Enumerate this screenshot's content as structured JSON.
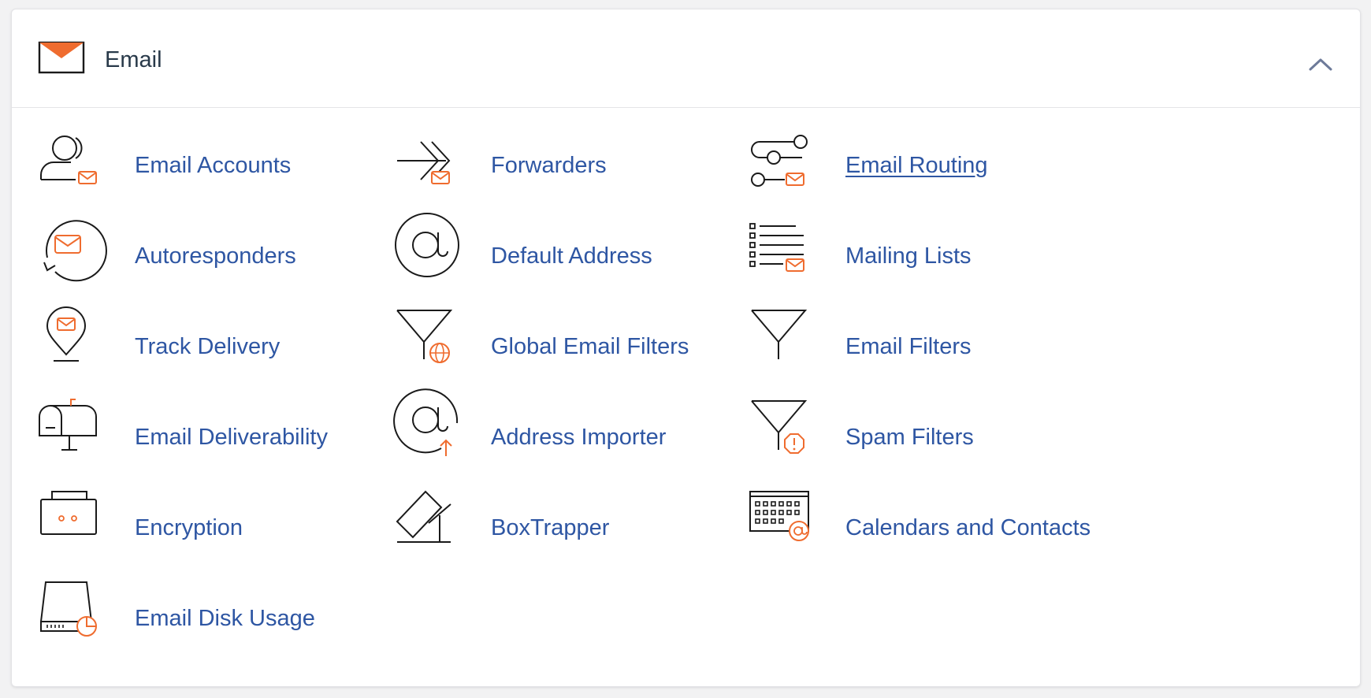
{
  "section": {
    "title": "Email",
    "icon": "envelope-icon",
    "collapse_icon": "chevron-up-icon"
  },
  "colors": {
    "link": "#2e56a3",
    "accent": "#ef6c2f",
    "icon_stroke": "#1a1a1a"
  },
  "items": [
    {
      "label": "Email Accounts",
      "icon": "user-mail-icon"
    },
    {
      "label": "Forwarders",
      "icon": "forward-arrow-icon"
    },
    {
      "label": "Email Routing",
      "icon": "routing-icon"
    },
    {
      "label": "Autoresponders",
      "icon": "autoresponder-icon"
    },
    {
      "label": "Default Address",
      "icon": "at-sign-icon"
    },
    {
      "label": "Mailing Lists",
      "icon": "list-mail-icon"
    },
    {
      "label": "Track Delivery",
      "icon": "location-pin-mail-icon"
    },
    {
      "label": "Global Email Filters",
      "icon": "filter-globe-icon"
    },
    {
      "label": "Email Filters",
      "icon": "filter-icon"
    },
    {
      "label": "Email Deliverability",
      "icon": "mailbox-icon"
    },
    {
      "label": "Address Importer",
      "icon": "at-sign-upload-icon"
    },
    {
      "label": "Spam Filters",
      "icon": "filter-warning-icon"
    },
    {
      "label": "Encryption",
      "icon": "lock-briefcase-icon"
    },
    {
      "label": "BoxTrapper",
      "icon": "box-trap-icon"
    },
    {
      "label": "Calendars and Contacts",
      "icon": "calendar-at-icon"
    },
    {
      "label": "Email Disk Usage",
      "icon": "disk-usage-icon"
    }
  ]
}
